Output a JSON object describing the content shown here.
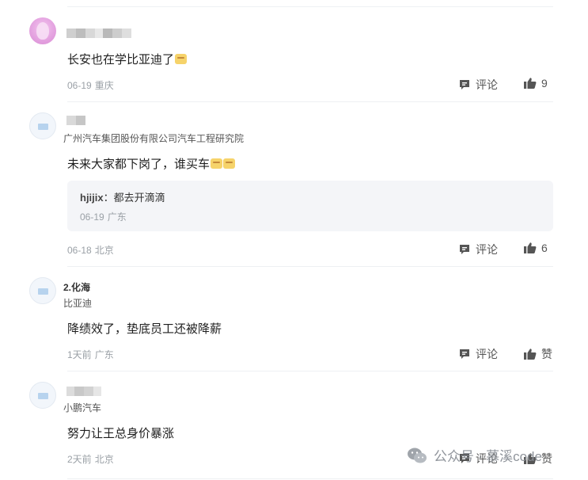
{
  "comments": [
    {
      "content": "长安也在学比亚迪了",
      "emojis": [
        "grin-emoji"
      ],
      "date": "06-19",
      "location": "重庆",
      "comment_label": "评论",
      "like_label": "9"
    },
    {
      "org": "广州汽车集团股份有限公司汽车工程研究院",
      "content": "未来大家都下岗了，谁买车",
      "emojis": [
        "grin-emoji",
        "grin-emoji"
      ],
      "reply": {
        "user": "hjijix",
        "sep": "：",
        "text": "都去开滴滴",
        "date": "06-19",
        "location": "广东"
      },
      "date": "06-18",
      "location": "北京",
      "comment_label": "评论",
      "like_label": "6"
    },
    {
      "author": "2.化海",
      "org": "比亚迪",
      "content": "降绩效了，垫底员工还被降薪",
      "date": "1天前",
      "location": "广东",
      "comment_label": "评论",
      "like_label": "赞"
    },
    {
      "org": "小鹏汽车",
      "content": "努力让王总身价暴涨",
      "date": "2天前",
      "location": "北京",
      "comment_label": "评论",
      "like_label": "赞"
    }
  ],
  "watermark": "公众号 · 慕溪code",
  "colors": {
    "text": "#1f1f1f",
    "meta": "#9aa0a6",
    "reply_bg": "#f4f5f8",
    "icon": "#555555"
  }
}
